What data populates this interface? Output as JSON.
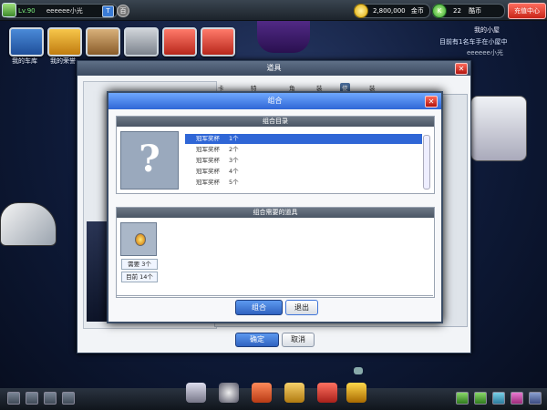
{
  "topbar": {
    "level": "Lv.90",
    "player_name": "eeeeee小光",
    "badge": "T",
    "mode": "百",
    "gold": "2,800,000",
    "gold_unit": "金币",
    "k_label": "K",
    "kcoin": "22",
    "kcoin_unit": "酷币",
    "recharge": "充值中心"
  },
  "nav": [
    {
      "label": "我的车库"
    },
    {
      "label": "我的荣誉"
    },
    {
      "label": ""
    },
    {
      "label": ""
    },
    {
      "label": ""
    },
    {
      "label": ""
    }
  ],
  "room": {
    "title": "我的小屋",
    "rank": "目前有1名车手在小屋中",
    "owner": "eeeeee小光"
  },
  "props_window": {
    "title": "道具",
    "tabs": [
      "卡丁车",
      "特品道具",
      "角色",
      "装备",
      "使用",
      "装饰道具"
    ],
    "active_tab": "使用",
    "confirm": "确定",
    "cancel": "取消"
  },
  "combine": {
    "title": "组合",
    "directory_header": "组合目录",
    "items": [
      {
        "name": "冠军奖杯",
        "count": "1个"
      },
      {
        "name": "冠军奖杯",
        "count": "2个"
      },
      {
        "name": "冠军奖杯",
        "count": "3个"
      },
      {
        "name": "冠军奖杯",
        "count": "4个"
      },
      {
        "name": "冠军奖杯",
        "count": "5个"
      }
    ],
    "selected_index": 0,
    "placeholder_glyph": "?",
    "required_header": "组合需要的道具",
    "need_label": "需要",
    "need_value": "3个",
    "have_label": "目前",
    "have_value": "14个",
    "combine_button": "组合",
    "exit_button": "退出"
  },
  "colors": {
    "accent_blue": "#2f66d6",
    "close_red": "#c8261a"
  }
}
